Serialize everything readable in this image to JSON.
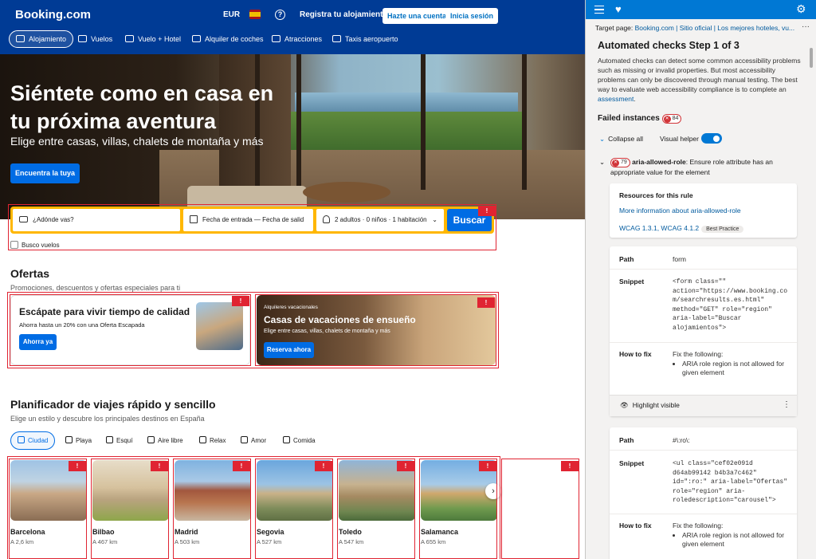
{
  "booking": {
    "header": {
      "logo": "Booking.com",
      "currency": "EUR",
      "help": "?",
      "list_property": "Registra tu alojamiento",
      "register": "Hazte una cuenta",
      "signin": "Inicia sesión"
    },
    "nav": [
      {
        "label": "Alojamiento",
        "icon": "bed-icon"
      },
      {
        "label": "Vuelos",
        "icon": "plane-icon"
      },
      {
        "label": "Vuelo + Hotel",
        "icon": "flight-hotel-icon"
      },
      {
        "label": "Alquiler de coches",
        "icon": "car-icon"
      },
      {
        "label": "Atracciones",
        "icon": "attractions-icon"
      },
      {
        "label": "Taxis aeropuerto",
        "icon": "taxi-icon"
      }
    ],
    "hero": {
      "title": "Siéntete como en casa en tu próxima aventura",
      "subtitle": "Elige entre casas, villas, chalets de montaña y más",
      "cta": "Encuentra la tuya"
    },
    "search": {
      "destination_placeholder": "¿Adónde vas?",
      "dates": "Fecha de entrada — Fecha de salid",
      "guests": "2 adultos · 0 niños · 1 habitación",
      "button": "Buscar",
      "flights_checkbox": "Busco vuelos"
    },
    "offers": {
      "title": "Ofertas",
      "subtitle": "Promociones, descuentos y ofertas especiales para ti",
      "card1": {
        "title": "Escápate para vivir tiempo de calidad",
        "desc": "Ahorra hasta un 20% con una Oferta Escapada",
        "button": "Ahorra ya"
      },
      "card2": {
        "kicker": "Alquileres vacacionales",
        "title": "Casas de vacaciones de ensueño",
        "desc": "Elige entre casas, villas, chalets de montaña y más",
        "button": "Reserva ahora"
      }
    },
    "planner": {
      "title": "Planificador de viajes rápido y sencillo",
      "subtitle": "Elige un estilo y descubre los principales destinos en España",
      "chips": [
        "Ciudad",
        "Playa",
        "Esquí",
        "Aire libre",
        "Relax",
        "Amor",
        "Comida"
      ],
      "cities": [
        {
          "name": "Barcelona",
          "distance": "A 2,6 km"
        },
        {
          "name": "Bilbao",
          "distance": "A 467 km"
        },
        {
          "name": "Madrid",
          "distance": "A 503 km"
        },
        {
          "name": "Segovia",
          "distance": "A 527 km"
        },
        {
          "name": "Toledo",
          "distance": "A 547 km"
        },
        {
          "name": "Salamanca",
          "distance": "A 655 km"
        }
      ],
      "arrow": "›"
    },
    "issue_flag": "!"
  },
  "panel": {
    "target_label": "Target page:",
    "target_link": "Booking.com | Sitio oficial | Los mejores hoteles, vu...",
    "more": "···",
    "title": "Automated checks Step 1 of 3",
    "description": "Automated checks can detect some common accessibility problems such as missing or invalid properties. But most accessibility problems can only be discovered through manual testing. The best way to evaluate web accessibility compliance is to complete an",
    "assessment_link": "assessment",
    "assessment_period": ".",
    "failed_label": "Failed instances",
    "failed_count": "84",
    "collapse_all": "Collapse all",
    "visual_helper": "Visual helper",
    "rule": {
      "count": "79",
      "id": "aria-allowed-role",
      "desc": ": Ensure role attribute has an appropriate value for the element"
    },
    "resources": {
      "heading": "Resources for this rule",
      "more_info": "More information about aria-allowed-role",
      "wcag": "WCAG 1.3.1, WCAG 4.1.2",
      "pill": "Best Practice"
    },
    "instance1": {
      "path_label": "Path",
      "path": "form",
      "snippet_label": "Snippet",
      "snippet": "<form class=\"\"\naction=\"https://www.booking.co\nm/searchresults.es.html\"\nmethod=\"GET\" role=\"region\"\naria-label=\"Buscar\nalojamientos\">",
      "fix_label": "How to fix",
      "fix_head": "Fix the following:",
      "fix_item": "ARIA role region is not allowed for given element",
      "highlight": "Highlight visible",
      "kebab": "⋮"
    },
    "instance2": {
      "path_label": "Path",
      "path": "#\\:ro\\:",
      "snippet_label": "Snippet",
      "snippet": "<ul class=\"cef02e091d\nd64ab99142 b4b3a7c462\"\nid=\":ro:\" aria-label=\"Ofertas\"\nrole=\"region\" aria-\nroledescription=\"carousel\">",
      "fix_label": "How to fix",
      "fix_head": "Fix the following:",
      "fix_item": "ARIA role region is not allowed for given element"
    }
  }
}
